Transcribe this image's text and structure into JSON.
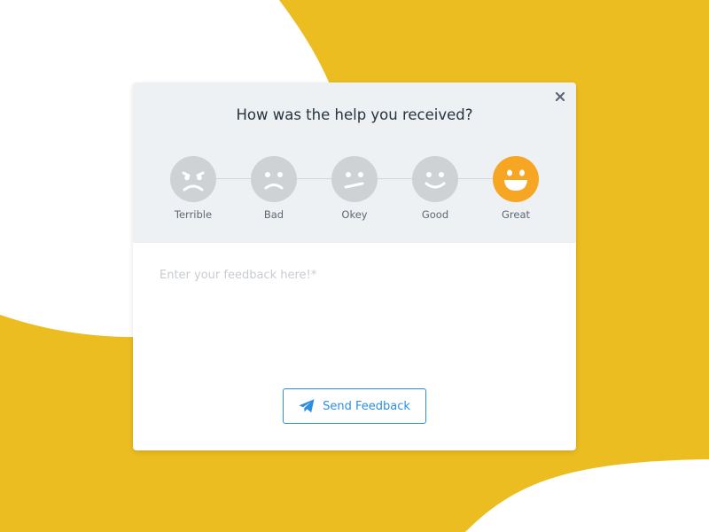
{
  "colors": {
    "background": "#ebbd20",
    "blob": "#ffffff",
    "header_bg": "#eef1f4",
    "face_inactive": "#cfd2d5",
    "face_active": "#f6a623",
    "accent": "#2d8ee1"
  },
  "dialog": {
    "title": "How was the help you received?",
    "close_icon": "close-icon",
    "rating": {
      "selected": "Great",
      "options": [
        {
          "label": "Terrible",
          "icon": "terrible-face-icon"
        },
        {
          "label": "Bad",
          "icon": "bad-face-icon"
        },
        {
          "label": "Okey",
          "icon": "okey-face-icon"
        },
        {
          "label": "Good",
          "icon": "good-face-icon"
        },
        {
          "label": "Great",
          "icon": "great-face-icon"
        }
      ]
    },
    "feedback": {
      "placeholder": "Enter your feedback here!*",
      "value": ""
    },
    "send_button": {
      "label": "Send Feedback",
      "icon": "paper-plane-icon"
    }
  }
}
